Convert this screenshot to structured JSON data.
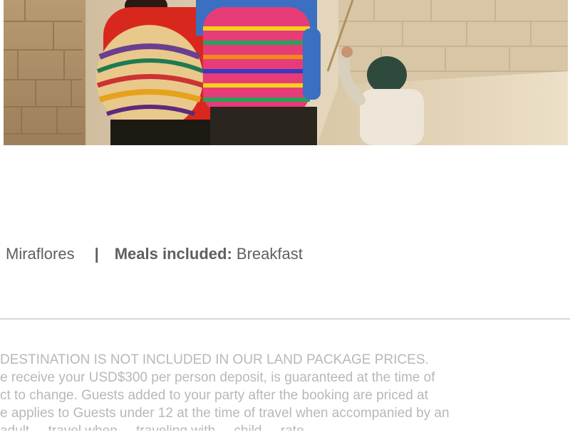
{
  "hero_image": {
    "alt_icon": "photo-andean-women-and-child"
  },
  "hotel_details": {
    "location": "Miraflores",
    "separator": "|",
    "meals_label": "Meals included:",
    "meals_value": "Breakfast"
  },
  "fine_print": {
    "lines": [
      "DESTINATION IS NOT INCLUDED IN OUR LAND PACKAGE PRICES.",
      "e receive your USD$300 per person deposit, is guaranteed at the time of",
      "ct to change. Guests added to your party after the booking are priced at",
      "e applies to Guests under 12 at the time of travel when accompanied by an",
      "adult ... travel when ... traveling with ... child ... rate ..."
    ]
  },
  "colors": {
    "text": "#5f5f5f",
    "fine_print": "#b8b8b8",
    "divider": "#d6d6d6"
  }
}
